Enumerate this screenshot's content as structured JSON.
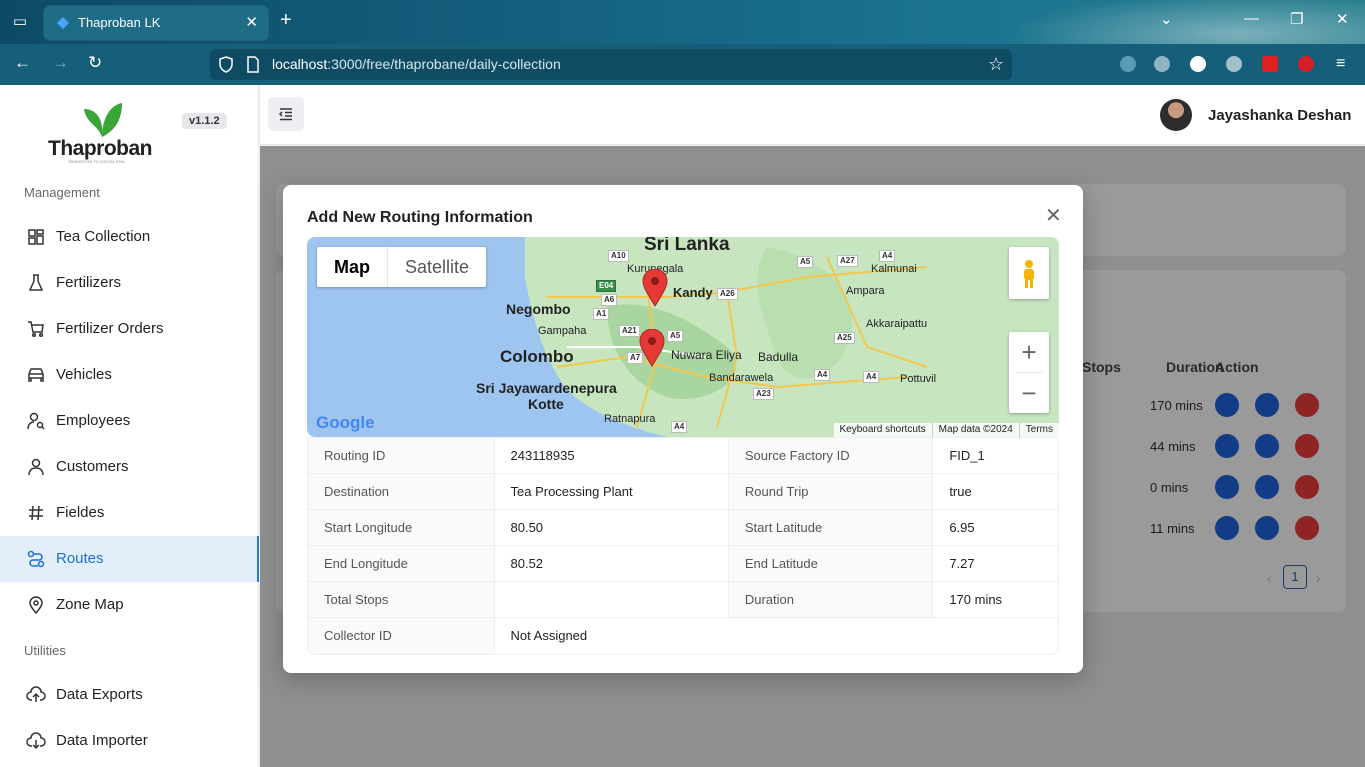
{
  "browser": {
    "tab_title": "Thaproban LK",
    "url_host": "localhost",
    "url_rest": ":3000/free/thaprobane/daily-collection"
  },
  "app": {
    "brand": "Thaproban",
    "tagline": "TRANSITION TO DIGITAL ERA",
    "version": "v1.1.2",
    "user_name": "Jayashanka Deshan"
  },
  "sidebar": {
    "section_management": "Management",
    "section_utilities": "Utilities",
    "items": [
      {
        "label": "Tea Collection",
        "icon": "grid-icon"
      },
      {
        "label": "Fertilizers",
        "icon": "flask-icon"
      },
      {
        "label": "Fertilizer Orders",
        "icon": "cart-icon"
      },
      {
        "label": "Vehicles",
        "icon": "car-icon"
      },
      {
        "label": "Employees",
        "icon": "user-search-icon"
      },
      {
        "label": "Customers",
        "icon": "user-icon"
      },
      {
        "label": "Fieldes",
        "icon": "hash-icon"
      },
      {
        "label": "Routes",
        "icon": "route-icon",
        "active": true
      },
      {
        "label": "Zone Map",
        "icon": "pin-icon"
      }
    ],
    "utilities": [
      {
        "label": "Data Exports",
        "icon": "cloud-upload-icon"
      },
      {
        "label": "Data Importer",
        "icon": "cloud-download-icon"
      }
    ]
  },
  "background_table": {
    "headers": [
      "Stops",
      "Duration",
      "Action"
    ],
    "durations": [
      "170 mins",
      "44 mins",
      "0 mins",
      "11 mins"
    ],
    "page": "1"
  },
  "modal": {
    "title": "Add New Routing Information",
    "map": {
      "type_map": "Map",
      "type_satellite": "Satellite",
      "country_label": "Sri Lanka",
      "places": [
        "Kurunegala",
        "Kandy",
        "Negombo",
        "Gampaha",
        "Colombo",
        "Sri Jayawardenepura",
        "Kotte",
        "Nuwara Eliya",
        "Badulla",
        "Bandarawela",
        "Ratnapura",
        "Kalmunai",
        "Ampara",
        "Akkaraipattu",
        "Pottuvil"
      ],
      "roads": [
        "A10",
        "E04",
        "A6",
        "A1",
        "A21",
        "A7",
        "A5",
        "A26",
        "A5",
        "A27",
        "A4",
        "A25",
        "A4",
        "A4",
        "A23",
        "A4"
      ],
      "google": "Google",
      "keyboard": "Keyboard shortcuts",
      "mapdata": "Map data ©2024",
      "terms": "Terms"
    },
    "rows": [
      {
        "k1": "Routing ID",
        "v1": "243118935",
        "k2": "Source Factory ID",
        "v2": "FID_1"
      },
      {
        "k1": "Destination",
        "v1": "Tea Processing Plant",
        "k2": "Round Trip",
        "v2": "true"
      },
      {
        "k1": "Start Longitude",
        "v1": "80.50",
        "k2": "Start Latitude",
        "v2": "6.95"
      },
      {
        "k1": "End Longitude",
        "v1": "80.52",
        "k2": "End Latitude",
        "v2": "7.27"
      },
      {
        "k1": "Total Stops",
        "v1": "",
        "k2": "Duration",
        "v2": "170 mins"
      }
    ],
    "collector_label": "Collector ID",
    "collector_value": "Not Assigned"
  }
}
